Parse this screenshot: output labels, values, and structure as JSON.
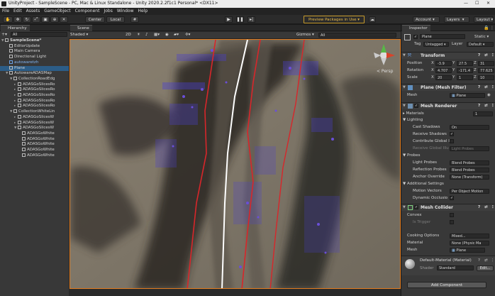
{
  "window": {
    "title": "UnityProject - SampleScene - PC, Mac & Linux Standalone - Unity 2020.2.2f1c1 Personal* <DX11>"
  },
  "menu": [
    "File",
    "Edit",
    "Assets",
    "GameObject",
    "Component",
    "Jobs",
    "Window",
    "Help"
  ],
  "toolbar": {
    "center_label": "Center",
    "local_label": "Local",
    "preview_packages": "Preview Packages in Use",
    "account": "Account",
    "layers": "Layers",
    "layout": "Layout"
  },
  "hierarchy": {
    "tab": "Hierarchy",
    "search_prefix": "All",
    "items": [
      {
        "label": "SampleScene*",
        "indent": 0,
        "sel": false,
        "blue": false,
        "tri": "▼"
      },
      {
        "label": "EditorUpdate",
        "indent": 1,
        "sel": false,
        "blue": false,
        "tri": ""
      },
      {
        "label": "Main Camera",
        "indent": 1,
        "sel": false,
        "blue": false,
        "tri": ""
      },
      {
        "label": "Directional Light",
        "indent": 1,
        "sel": false,
        "blue": false,
        "tri": ""
      },
      {
        "label": "autowaretzh",
        "indent": 1,
        "sel": false,
        "blue": true,
        "tri": ""
      },
      {
        "label": "Plane",
        "indent": 1,
        "sel": true,
        "blue": false,
        "tri": ""
      },
      {
        "label": "AutowareADASMap",
        "indent": 1,
        "sel": false,
        "blue": false,
        "tri": "▼"
      },
      {
        "label": "CollectionRoadEdg",
        "indent": 2,
        "sel": false,
        "blue": false,
        "tri": "▼"
      },
      {
        "label": "ADASGoSlicesRo",
        "indent": 3,
        "sel": false,
        "blue": false,
        "tri": "▸"
      },
      {
        "label": "ADASGoSlicesRo",
        "indent": 3,
        "sel": false,
        "blue": false,
        "tri": "▸"
      },
      {
        "label": "ADASGoSlicesRo",
        "indent": 3,
        "sel": false,
        "blue": false,
        "tri": "▸"
      },
      {
        "label": "ADASGoSlicesRo",
        "indent": 3,
        "sel": false,
        "blue": false,
        "tri": "▸"
      },
      {
        "label": "ADASGoSlicesRo",
        "indent": 3,
        "sel": false,
        "blue": false,
        "tri": "▸"
      },
      {
        "label": "CollectionWhiteLin",
        "indent": 2,
        "sel": false,
        "blue": false,
        "tri": "▼"
      },
      {
        "label": "ADASGoSlicesW",
        "indent": 3,
        "sel": false,
        "blue": false,
        "tri": "▸"
      },
      {
        "label": "ADASGoSlicesW",
        "indent": 3,
        "sel": false,
        "blue": false,
        "tri": "▸"
      },
      {
        "label": "ADASGoSlicesW",
        "indent": 3,
        "sel": false,
        "blue": false,
        "tri": "▼"
      },
      {
        "label": "ADASGoWhite",
        "indent": 4,
        "sel": false,
        "blue": false,
        "tri": ""
      },
      {
        "label": "ADASGoWhite",
        "indent": 4,
        "sel": false,
        "blue": false,
        "tri": ""
      },
      {
        "label": "ADASGoWhite",
        "indent": 4,
        "sel": false,
        "blue": false,
        "tri": ""
      },
      {
        "label": "ADASGoWhite",
        "indent": 4,
        "sel": false,
        "blue": false,
        "tri": ""
      },
      {
        "label": "ADASGoWhite",
        "indent": 4,
        "sel": false,
        "blue": false,
        "tri": ""
      }
    ]
  },
  "scene": {
    "tab": "Scene",
    "shading": "Shaded",
    "mode2d": "2D",
    "gizmos": "Gizmos",
    "search_prefix": "All",
    "persp_label": "< Persp"
  },
  "inspector": {
    "tab": "Inspector",
    "name": "Plane",
    "static": "Static",
    "tag_label": "Tag",
    "tag": "Untagged",
    "layer_label": "Layer",
    "layer": "Default",
    "transform": {
      "title": "Transform",
      "position_label": "Position",
      "pos": [
        "-3.9",
        "27.5",
        "31"
      ],
      "rotation_label": "Rotation",
      "rot": [
        "4.707",
        "-171.4",
        "77.625"
      ],
      "scale_label": "Scale",
      "scl": [
        "20",
        "1",
        "10"
      ],
      "x": "X",
      "y": "Y",
      "z": "Z"
    },
    "mesh_filter": {
      "title": "Plane (Mesh Filter)",
      "mesh_label": "Mesh",
      "mesh": "Plane"
    },
    "mesh_renderer": {
      "title": "Mesh Renderer",
      "materials": "Materials",
      "materials_count": "1",
      "lighting": "Lighting",
      "cast_shadows_label": "Cast Shadows",
      "cast_shadows": "On",
      "receive_shadows_label": "Receive Shadows",
      "contribute_gi_label": "Contribute Global I",
      "receive_gi_label": "Receive Global Illu",
      "receive_gi": "Light Probes",
      "probes": "Probes",
      "light_probes_label": "Light Probes",
      "light_probes": "Blend Probes",
      "reflection_probes_label": "Reflection Probes",
      "reflection_probes": "Blend Probes",
      "anchor_override_label": "Anchor Override",
      "anchor_override": "None (Transform)",
      "additional": "Additional Settings",
      "motion_vectors_label": "Motion Vectors",
      "motion_vectors": "Per Object Motion",
      "dynamic_occlusion_label": "Dynamic Occlusio"
    },
    "mesh_collider": {
      "title": "Mesh Collider",
      "convex": "Convex",
      "is_trigger": "Is Trigger",
      "cooking_label": "Cooking Options",
      "cooking": "Mixed...",
      "material_label": "Material",
      "material": "None (Physic Ma",
      "mesh_label": "Mesh",
      "mesh": "Plane"
    },
    "material": {
      "name": "Default-Material (Material)",
      "shader_label": "Shader",
      "shader": "Standard",
      "edit": "Edit..."
    },
    "add_component": "Add Component"
  },
  "colors": {
    "accent": "#e07a1e",
    "selection": "#2c5d87",
    "panel": "#383838"
  }
}
